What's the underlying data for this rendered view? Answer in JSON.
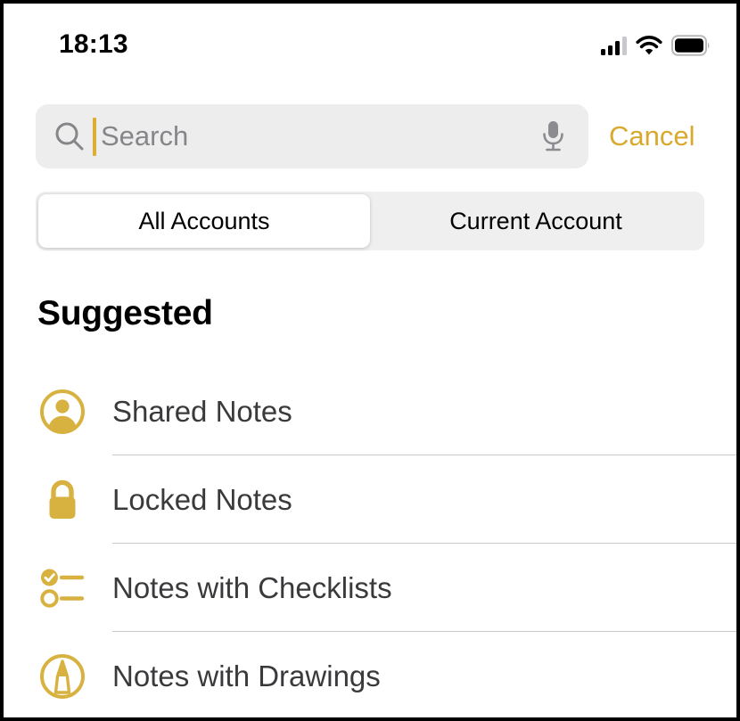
{
  "status_bar": {
    "time": "18:13",
    "cellular_icon": "cellular-signal-icon",
    "cellular_bars_filled": 3,
    "cellular_bars_total": 4,
    "wifi_icon": "wifi-icon",
    "battery_icon": "battery-full-icon"
  },
  "search": {
    "icon": "search-icon",
    "placeholder": "Search",
    "value": "",
    "cursor_visible": true,
    "mic_icon": "microphone-icon",
    "cancel_label": "Cancel"
  },
  "scope_bar": {
    "options": [
      {
        "label": "All Accounts",
        "selected": true
      },
      {
        "label": "Current Account",
        "selected": false
      }
    ]
  },
  "section": {
    "title": "Suggested"
  },
  "suggestions": [
    {
      "icon": "shared-person-icon",
      "label": "Shared Notes"
    },
    {
      "icon": "lock-icon",
      "label": "Locked Notes"
    },
    {
      "icon": "checklist-icon",
      "label": "Notes with Checklists"
    },
    {
      "icon": "drawing-pen-icon",
      "label": "Notes with Drawings"
    }
  ],
  "colors": {
    "accent_gold": "#d9a92e",
    "icon_gold": "#d8b240",
    "field_background": "#ededed",
    "segment_background": "#efeff0",
    "label_text": "#3a3a3c",
    "placeholder_text": "#86868a",
    "divider": "#c9c9cc"
  }
}
